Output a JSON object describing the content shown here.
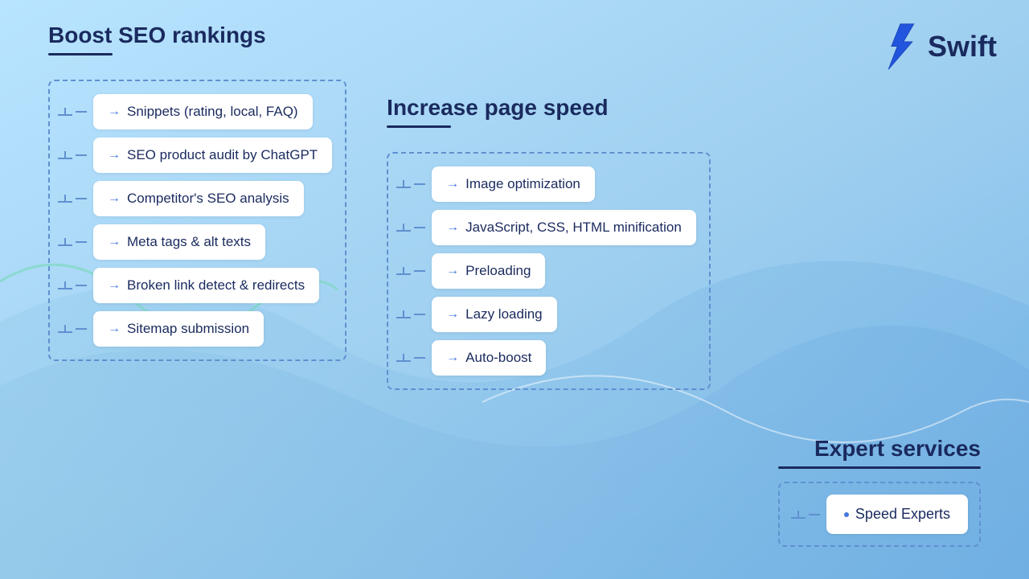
{
  "logo": {
    "text": "Swift"
  },
  "columns": {
    "seo": {
      "title": "Boost SEO rankings",
      "items": [
        "Snippets (rating, local, FAQ)",
        "SEO product audit by ChatGPT",
        "Competitor's SEO analysis",
        "Meta tags & alt texts",
        "Broken link detect & redirects",
        "Sitemap submission"
      ]
    },
    "speed": {
      "title": "Increase page speed",
      "items": [
        "Image optimization",
        "JavaScript, CSS, HTML minification",
        "Preloading",
        "Lazy loading",
        "Auto-boost"
      ]
    },
    "expert": {
      "title": "Expert services",
      "items": [
        "Speed Experts"
      ]
    }
  }
}
